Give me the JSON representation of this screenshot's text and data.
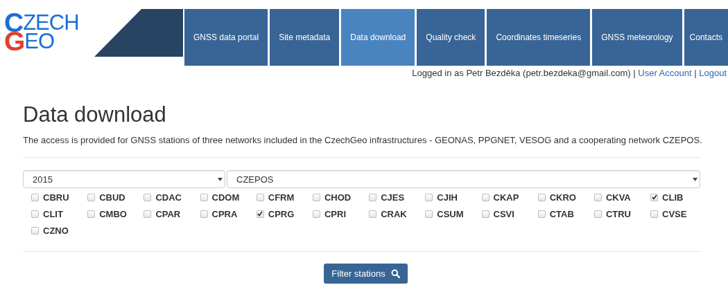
{
  "logo": {
    "lines": [
      {
        "initial": "C",
        "rest": "ZECH",
        "color": "#1a6fd6"
      },
      {
        "initial": "G",
        "rest": "EO",
        "color": "#e0402a"
      }
    ]
  },
  "nav": [
    {
      "label": "GNSS data portal",
      "selected": false
    },
    {
      "label": "Site metadata",
      "selected": false
    },
    {
      "label": "Data download",
      "selected": true
    },
    {
      "label": "Quality check",
      "selected": false
    },
    {
      "label": "Coordinates timeseries",
      "selected": false
    },
    {
      "label": "GNSS meteorology",
      "selected": false
    },
    {
      "label": "Contacts",
      "selected": false
    }
  ],
  "user_bar": {
    "text": "Logged in as Petr Bezděka (petr.bezdeka@gmail.com)",
    "links": [
      {
        "separator": "|",
        "label": "User Account"
      },
      {
        "separator": "|",
        "label": "Logout"
      }
    ]
  },
  "page": {
    "title": "Data download",
    "description": "The access is provided for GNSS stations of three networks included in the CzechGeo infrastructures - GEONAS, PPGNET, VESOG and a cooperating network CZEPOS."
  },
  "filters": {
    "year": "2015",
    "network": "CZEPOS"
  },
  "stations": [
    {
      "name": "CBRU",
      "checked": false
    },
    {
      "name": "CBUD",
      "checked": false
    },
    {
      "name": "CDAC",
      "checked": false
    },
    {
      "name": "CDOM",
      "checked": false
    },
    {
      "name": "CFRM",
      "checked": false
    },
    {
      "name": "CHOD",
      "checked": false
    },
    {
      "name": "CJES",
      "checked": false
    },
    {
      "name": "CJIH",
      "checked": false
    },
    {
      "name": "CKAP",
      "checked": false
    },
    {
      "name": "CKRO",
      "checked": false
    },
    {
      "name": "CKVA",
      "checked": false
    },
    {
      "name": "CLIB",
      "checked": true
    },
    {
      "name": "CLIT",
      "checked": false
    },
    {
      "name": "CMBO",
      "checked": false
    },
    {
      "name": "CPAR",
      "checked": false
    },
    {
      "name": "CPRA",
      "checked": false
    },
    {
      "name": "CPRG",
      "checked": true
    },
    {
      "name": "CPRI",
      "checked": false
    },
    {
      "name": "CRAK",
      "checked": false
    },
    {
      "name": "CSUM",
      "checked": false
    },
    {
      "name": "CSVI",
      "checked": false
    },
    {
      "name": "CTAB",
      "checked": false
    },
    {
      "name": "CTRU",
      "checked": false
    },
    {
      "name": "CVSE",
      "checked": false
    },
    {
      "name": "CZNO",
      "checked": false
    }
  ],
  "submit": {
    "label": "Filter stations"
  }
}
